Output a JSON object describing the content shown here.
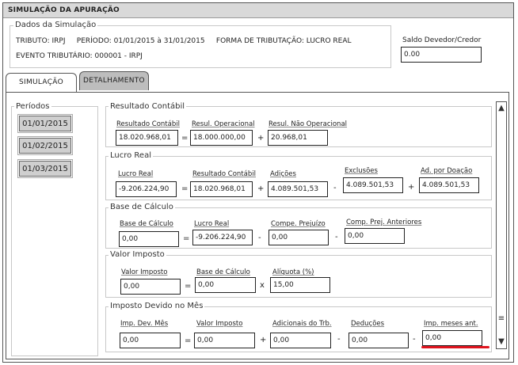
{
  "window": {
    "title": "SIMULAÇÃO DA APURAÇÃO"
  },
  "dados": {
    "legend": "Dados da Simulação",
    "line1": "TRIBUTO: IRPJ     PERÍODO: 01/01/2015 à 31/01/2015     FORMA DE TRIBUTAÇÃO: LUCRO REAL",
    "line2": "EVENTO TRIBUTÁRIO: 000001 - IRPJ"
  },
  "saldo": {
    "label": "Saldo Devedor/Credor",
    "value": "0.00"
  },
  "tabs": [
    {
      "label": "SIMULAÇÃO",
      "active": true
    },
    {
      "label": "DETALHAMENTO",
      "active": false
    }
  ],
  "periodos": {
    "legend": "Períodos",
    "items": [
      "01/01/2015",
      "01/02/2015",
      "01/03/2015"
    ]
  },
  "resultado_contabil": {
    "legend": "Resultado Contábil",
    "fields": [
      {
        "label": "Resultado Contábil",
        "value": "18.020.968,01"
      },
      {
        "label": "Resul. Operacional",
        "value": "18.000.000,00"
      },
      {
        "label": "Resul. Não Operacional",
        "value": "20.968,01"
      }
    ],
    "ops": [
      "=",
      "+"
    ]
  },
  "lucro_real": {
    "legend": "Lucro Real",
    "fields": [
      {
        "label": "Lucro Real",
        "value": "-9.206.224,90"
      },
      {
        "label": "Resultado Contábil",
        "value": "18.020.968,01"
      },
      {
        "label": "Adições",
        "value": "4.089.501,53"
      },
      {
        "label": "Exclusões",
        "value": "4.089.501,53"
      },
      {
        "label": "Ad. por Doação",
        "value": "4.089.501,53"
      }
    ],
    "ops": [
      "=",
      "+",
      "-",
      "+"
    ]
  },
  "base_calculo": {
    "legend": "Base de Cálculo",
    "fields": [
      {
        "label": "Base de Cálculo",
        "value": "0,00"
      },
      {
        "label": "Lucro Real",
        "value": "-9.206.224,90"
      },
      {
        "label": "Compe. Prejuízo",
        "value": "0,00"
      },
      {
        "label": "Comp. Prej. Anteriores",
        "value": "0,00"
      }
    ],
    "ops": [
      "=",
      "-",
      "-"
    ]
  },
  "valor_imposto": {
    "legend": "Valor Imposto",
    "fields": [
      {
        "label": "Valor Imposto",
        "value": "0,00"
      },
      {
        "label": "Base de Cálculo",
        "value": "0,00"
      },
      {
        "label": "Alíquota (%)",
        "value": "15,00"
      }
    ],
    "ops": [
      "=",
      "x"
    ]
  },
  "imposto_devido": {
    "legend": "Imposto Devido no Mês",
    "fields": [
      {
        "label": "Imp. Dev. Mês",
        "value": "0,00"
      },
      {
        "label": "Valor Imposto",
        "value": "0,00"
      },
      {
        "label": "Adicionais do Trb.",
        "value": "0,00"
      },
      {
        "label": "Deduções",
        "value": "0,00"
      },
      {
        "label": "Imp. meses ant.",
        "value": "0,00"
      }
    ],
    "ops": [
      "=",
      "+",
      "-",
      "-"
    ]
  },
  "scrollbar": {
    "up": "▲",
    "down": "▼",
    "thumb": "≡"
  },
  "colors": {
    "highlight": "#e0141e",
    "tab_inactive": "#bdbdbd",
    "button": "#cfcfcf"
  }
}
